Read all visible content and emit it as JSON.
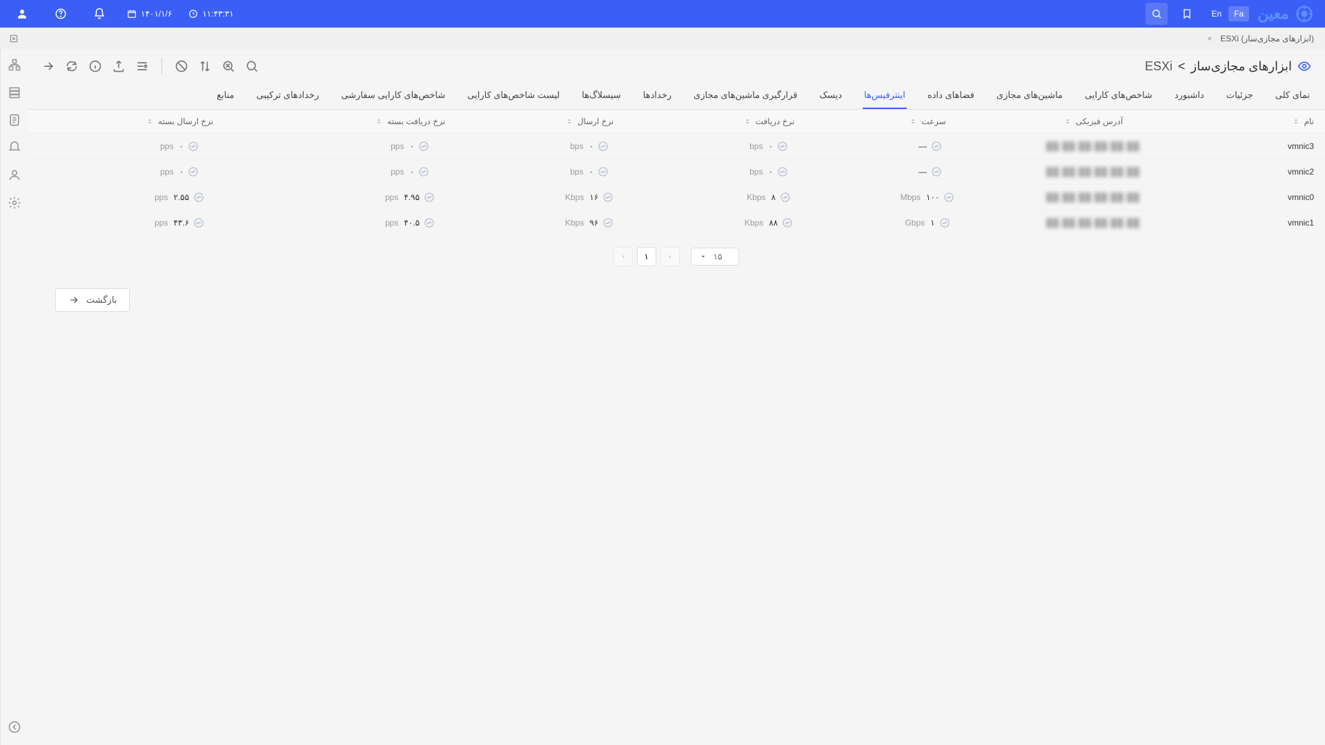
{
  "header": {
    "date": "۱۴۰۱/۱/۶",
    "time": "۱۱:۴۳:۳۱",
    "lang_en": "En",
    "lang_fa": "Fa",
    "logo_text": "معین"
  },
  "doc_tab": {
    "title": "ESXi (ابزارهای مجازی‌ساز)"
  },
  "breadcrumb": {
    "parent": "ابزارهای مجازی‌ساز",
    "sep": ">",
    "current": "ESXi"
  },
  "tabs": [
    {
      "label": "نمای کلی"
    },
    {
      "label": "جزئیات"
    },
    {
      "label": "داشبورد"
    },
    {
      "label": "شاخص‌های کارایی"
    },
    {
      "label": "ماشین‌های مجازی"
    },
    {
      "label": "فضاهای داده"
    },
    {
      "label": "اینترفیس‌ها",
      "active": true
    },
    {
      "label": "دیسک"
    },
    {
      "label": "قرارگیری ماشین‌های مجازی"
    },
    {
      "label": "رخدادها"
    },
    {
      "label": "سیسلاگ‌ها"
    },
    {
      "label": "لیست شاخص‌های کارایی"
    },
    {
      "label": "شاخص‌های کارایی سفارشی"
    },
    {
      "label": "رخدادهای ترکیبی"
    },
    {
      "label": "منابع"
    }
  ],
  "columns": {
    "name": "نام",
    "addr": "آدرس فیزیکی",
    "speed": "سرعت",
    "rx": "نرخ دریافت",
    "tx": "نرخ ارسال",
    "rxp": "نرخ دریافت بسته",
    "txp": "نرخ ارسال بسته"
  },
  "rows": [
    {
      "name": "vmnic3",
      "addr": "██:██:██:██:██:██",
      "speed": "—",
      "speed_unit": "",
      "rx": "۰",
      "rx_unit": "bps",
      "tx": "۰",
      "tx_unit": "bps",
      "rxp": "۰",
      "rxp_unit": "pps",
      "txp": "۰",
      "txp_unit": "pps"
    },
    {
      "name": "vmnic2",
      "addr": "██:██:██:██:██:██",
      "speed": "—",
      "speed_unit": "",
      "rx": "۰",
      "rx_unit": "bps",
      "tx": "۰",
      "tx_unit": "bps",
      "rxp": "۰",
      "rxp_unit": "pps",
      "txp": "۰",
      "txp_unit": "pps"
    },
    {
      "name": "vmnic0",
      "addr": "██:██:██:██:██:██",
      "speed": "۱۰۰",
      "speed_unit": "Mbps",
      "rx": "۸",
      "rx_unit": "Kbps",
      "tx": "۱۶",
      "tx_unit": "Kbps",
      "rxp": "۴.۹۵",
      "rxp_unit": "pps",
      "txp": "۲.۵۵",
      "txp_unit": "pps"
    },
    {
      "name": "vmnic1",
      "addr": "██:██:██:██:██:██",
      "speed": "۱",
      "speed_unit": "Gbps",
      "rx": "۸۸",
      "rx_unit": "Kbps",
      "tx": "۹۶",
      "tx_unit": "Kbps",
      "rxp": "۴۰.۵",
      "rxp_unit": "pps",
      "txp": "۴۳.۶",
      "txp_unit": "pps"
    }
  ],
  "pagination": {
    "page": "۱",
    "size": "۱۵"
  },
  "back": "بازگشت"
}
